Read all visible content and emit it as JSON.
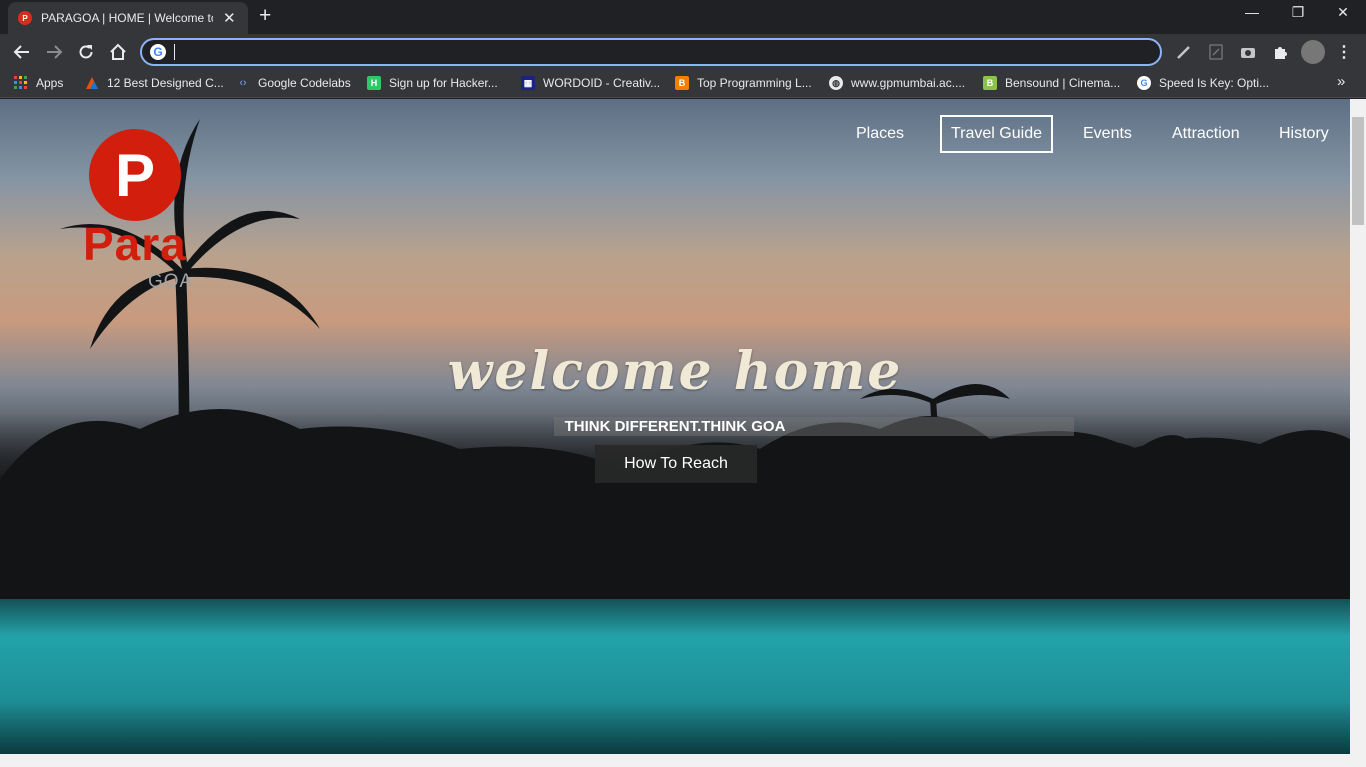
{
  "browser": {
    "tab_title": "PARAGOA | HOME | Welcome to Goa",
    "tab_favicon_letter": "P",
    "new_tab": "+",
    "omnibox_value": "",
    "window_controls": {
      "minimize": "—",
      "restore": "❐",
      "close": "✕"
    },
    "bookmarks": [
      {
        "label": "Apps",
        "icon": "apps-grid-icon",
        "color": "#ea4335"
      },
      {
        "label": "12 Best Designed C...",
        "icon": "triangle-icon",
        "color": "#e65100"
      },
      {
        "label": "Google Codelabs",
        "icon": "code-icon",
        "color": "#5f6368"
      },
      {
        "label": "Sign up for Hacker...",
        "icon": "hackerrank-icon",
        "color": "#2ec866"
      },
      {
        "label": "WORDOID - Creativ...",
        "icon": "wordoid-icon",
        "color": "#1a237e"
      },
      {
        "label": "Top Programming L...",
        "icon": "blogger-icon",
        "color": "#f57d00"
      },
      {
        "label": "www.gpmumbai.ac....",
        "icon": "globe-icon",
        "color": "#e8eaed"
      },
      {
        "label": "Bensound | Cinema...",
        "icon": "bensound-icon",
        "color": "#8bc34a"
      },
      {
        "label": "Speed Is Key: Opti...",
        "icon": "google-icon",
        "color": "#ffffff"
      }
    ],
    "bookmarks_more": "»"
  },
  "site": {
    "logo_letter": "P",
    "logo_word": "Para",
    "logo_sub": "GOA",
    "nav": [
      "Places",
      "Travel Guide",
      "Events",
      "Attraction",
      "History"
    ],
    "nav_active": "Travel Guide",
    "hero_title": "welcome home",
    "tagline": "THINK DIFFERENT.THINK GOA",
    "cta": "How To Reach",
    "brand_color": "#d21f0d"
  }
}
